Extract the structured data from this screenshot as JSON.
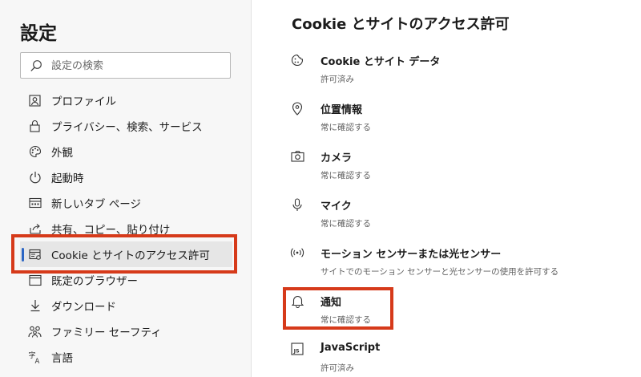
{
  "sidebar": {
    "title": "設定",
    "search_placeholder": "設定の検索",
    "items": [
      {
        "label": "プロファイル",
        "icon": "profile-icon"
      },
      {
        "label": "プライバシー、検索、サービス",
        "icon": "lock-icon"
      },
      {
        "label": "外観",
        "icon": "palette-icon"
      },
      {
        "label": "起動時",
        "icon": "power-icon"
      },
      {
        "label": "新しいタブ ページ",
        "icon": "new-tab-icon"
      },
      {
        "label": "共有、コピー、貼り付け",
        "icon": "share-icon"
      },
      {
        "label": "Cookie とサイトのアクセス許可",
        "icon": "site-permissions-icon",
        "active": true
      },
      {
        "label": "既定のブラウザー",
        "icon": "default-browser-icon"
      },
      {
        "label": "ダウンロード",
        "icon": "download-icon"
      },
      {
        "label": "ファミリー セーフティ",
        "icon": "family-icon"
      },
      {
        "label": "言語",
        "icon": "language-icon"
      },
      {
        "label": "",
        "icon": "partial-item-icon"
      }
    ]
  },
  "main": {
    "title": "Cookie とサイトのアクセス許可",
    "permissions": [
      {
        "name": "Cookie とサイト データ",
        "status": "許可済み",
        "icon": "cookie-icon"
      },
      {
        "name": "位置情報",
        "status": "常に確認する",
        "icon": "location-pin-icon"
      },
      {
        "name": "カメラ",
        "status": "常に確認する",
        "icon": "camera-icon"
      },
      {
        "name": "マイク",
        "status": "常に確認する",
        "icon": "microphone-icon"
      },
      {
        "name": "モーション センサーまたは光センサー",
        "status": "サイトでのモーション センサーと光センサーの使用を許可する",
        "icon": "sensor-icon"
      },
      {
        "name": "通知",
        "status": "常に確認する",
        "icon": "bell-icon"
      },
      {
        "name": "JavaScript",
        "status": "許可済み",
        "icon": "javascript-icon"
      }
    ]
  },
  "colors": {
    "highlight": "#d63a1a",
    "active_indicator": "#2c66c4",
    "sidebar_background": "#f7f7f7",
    "active_background": "#e6e6e6"
  }
}
